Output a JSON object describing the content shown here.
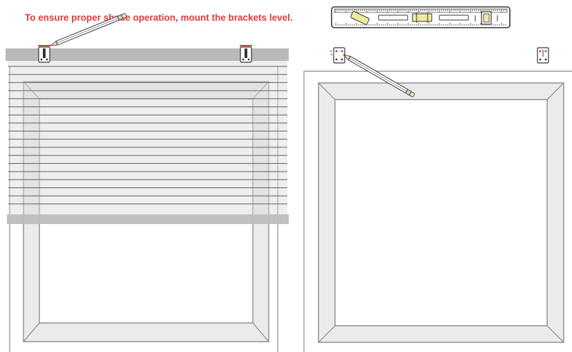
{
  "instruction": {
    "text": "To ensure proper shade operation, mount the brackets level."
  },
  "colors": {
    "accent": "#e03a3c",
    "outline": "#7a7a7a",
    "frame_fill": "#ebebeb",
    "header_rail": "#b9b9b9",
    "bottom_rail": "#bdbdbd",
    "slat_line": "#5e5e5e",
    "level_vial": "#f2eaa0"
  },
  "icons": [
    "level-icon",
    "pencil-icon",
    "mounting-bracket-icon",
    "window-frame-icon",
    "pleated-shade-icon"
  ]
}
